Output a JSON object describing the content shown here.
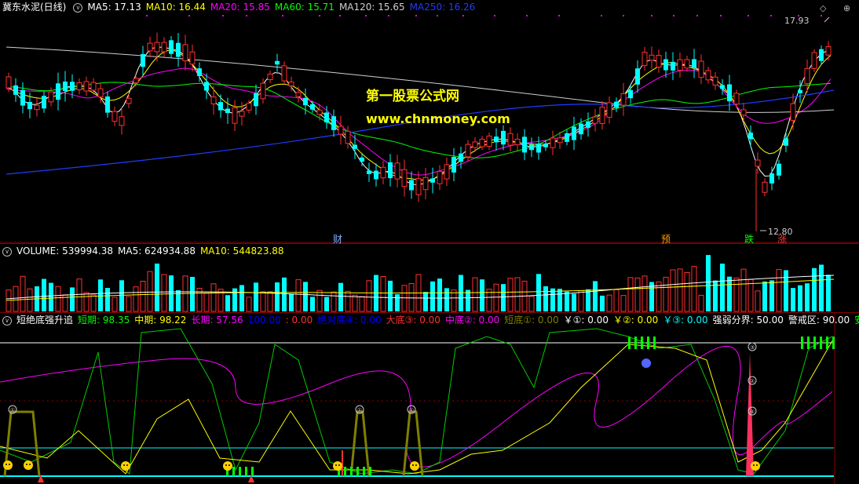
{
  "main": {
    "stock_label": "冀东水泥(日线)",
    "ma": [
      {
        "label": "MA5: 17.13",
        "color": "#ffffff"
      },
      {
        "label": "MA10: 16.44",
        "color": "#ffff00"
      },
      {
        "label": "MA20: 15.85",
        "color": "#ff00ff"
      },
      {
        "label": "MA60: 15.71",
        "color": "#00ff00"
      },
      {
        "label": "MA120: 15.65",
        "color": "#d0d0d0"
      },
      {
        "label": "MA250: 16.26",
        "color": "#1e3cff"
      }
    ],
    "high_label": "17.93",
    "low_label": "12.80",
    "watermark_cn": "第一股票公式网",
    "watermark_url": "www.chnmoney.com",
    "markers": [
      {
        "text": "财",
        "color": "#7fb0ff"
      },
      {
        "text": "预",
        "color": "#ff9900"
      },
      {
        "text": "跌",
        "color": "#00ff00"
      },
      {
        "text": "涨",
        "color": "#ff3030"
      }
    ],
    "controls": {
      "diamond": "◇",
      "plus": "⊕",
      "dots_label": "....",
      "chevron": "∨"
    }
  },
  "volume": {
    "title": "VOLUME: 539994.38",
    "ma5": "MA5: 624934.88",
    "ma10": "MA10: 544823.88",
    "colors": {
      "title": "#ffffff",
      "ma5": "#ffffff",
      "ma10": "#ffff00"
    }
  },
  "indicator": {
    "name": "短绝底强升追",
    "items": [
      {
        "label": "短期: 98.35",
        "color": "#00ff00"
      },
      {
        "label": "中期: 98.22",
        "color": "#ffff00"
      },
      {
        "label": "长期: 57.56",
        "color": "#ff00ff"
      },
      {
        "label": "100.00",
        "color": "#0000ff"
      },
      {
        "label": ": 0.00",
        "color": "#ff3030"
      },
      {
        "label": "绝对底④: 0.00",
        "color": "#0000ff"
      },
      {
        "label": "大底③: 0.00",
        "color": "#ff3030"
      },
      {
        "label": "中底②: 0.00",
        "color": "#ff00ff"
      },
      {
        "label": "短底①: 0.00",
        "color": "#808000"
      },
      {
        "label": "￥①: 0.00",
        "color": "#ffffff"
      },
      {
        "label": "￥②: 0.00",
        "color": "#ffff00"
      },
      {
        "label": "￥③: 0.00",
        "color": "#00ffff"
      },
      {
        "label": "强弱分界: 50.00",
        "color": "#ffffff"
      },
      {
        "label": "警戒区: 90.00",
        "color": "#ffffff"
      },
      {
        "label": "安全",
        "color": "#00ff00"
      }
    ],
    "circle_labels": [
      "①",
      "②",
      "③",
      "④"
    ]
  },
  "icons": {
    "expand": "expand-circle-icon"
  }
}
